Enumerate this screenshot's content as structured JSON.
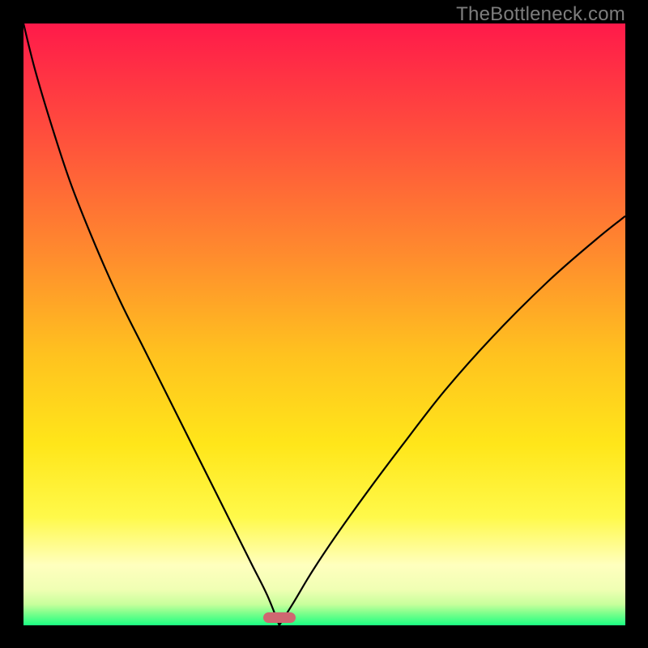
{
  "watermark": "TheBottleneck.com",
  "colors": {
    "background": "#000000",
    "curve": "#000000",
    "marker": "#cf6771"
  },
  "chart_data": {
    "type": "line",
    "title": "",
    "xlabel": "",
    "ylabel": "",
    "xlim": [
      0,
      100
    ],
    "ylim": [
      0,
      100
    ],
    "gradient_stops": [
      {
        "pct": 0,
        "color": "#ff1a4a"
      },
      {
        "pct": 18,
        "color": "#ff4d3d"
      },
      {
        "pct": 38,
        "color": "#ff8a2e"
      },
      {
        "pct": 55,
        "color": "#ffc21f"
      },
      {
        "pct": 70,
        "color": "#ffe61a"
      },
      {
        "pct": 82,
        "color": "#fff94a"
      },
      {
        "pct": 90,
        "color": "#ffffbe"
      },
      {
        "pct": 94,
        "color": "#f0ffb4"
      },
      {
        "pct": 96.5,
        "color": "#c8ff9c"
      },
      {
        "pct": 98,
        "color": "#7dff8c"
      },
      {
        "pct": 100,
        "color": "#1bff82"
      }
    ],
    "series": [
      {
        "name": "left-branch",
        "x": [
          0,
          2,
          5,
          8,
          12,
          16,
          20,
          24,
          28,
          32,
          35,
          38,
          40.5,
          42.5
        ],
        "y": [
          100,
          92,
          82,
          73,
          63,
          54,
          46,
          38,
          30,
          22,
          16,
          10,
          5,
          0
        ]
      },
      {
        "name": "right-branch",
        "x": [
          42.5,
          45,
          48,
          52,
          57,
          63,
          70,
          78,
          87,
          95,
          100
        ],
        "y": [
          0,
          4,
          9,
          15,
          22,
          30,
          39,
          48,
          57,
          64,
          68
        ]
      }
    ],
    "marker": {
      "x": 42.5,
      "y": 0,
      "color": "#cf6771"
    }
  }
}
